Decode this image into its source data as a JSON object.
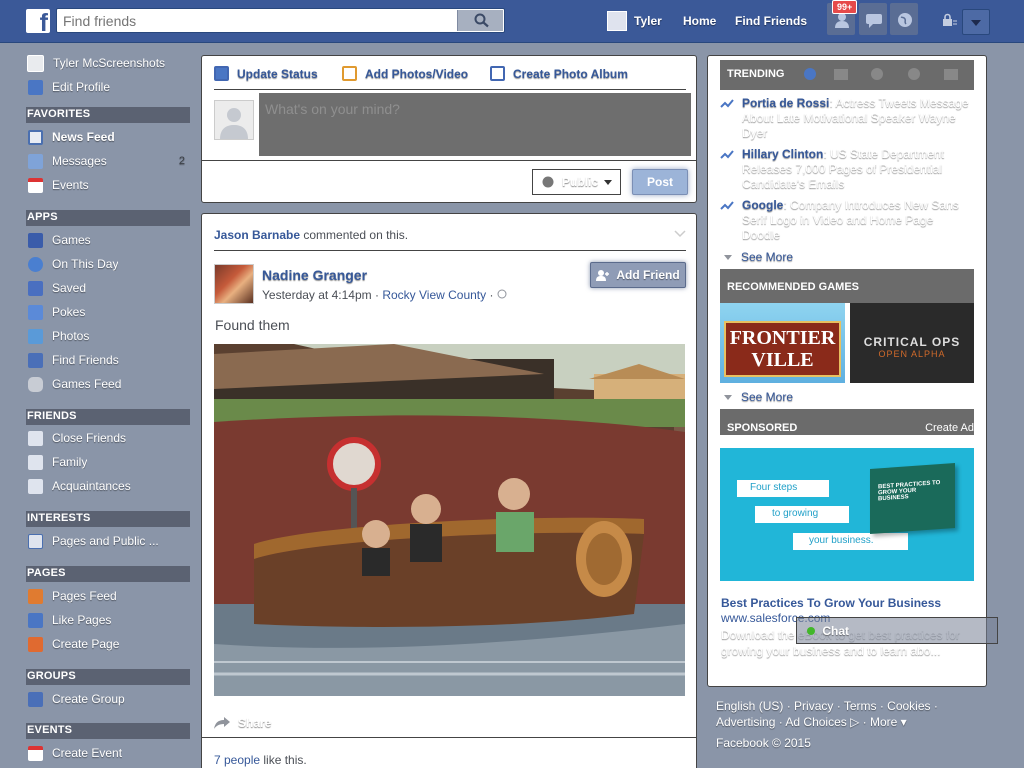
{
  "topbar": {
    "logo": "f",
    "search_placeholder": "Find friends",
    "user_name": "Tyler",
    "home_label": "Home",
    "find_friends_label": "Find Friends",
    "notification_count": "99+",
    "brand_color": "#3b5998"
  },
  "leftnav": {
    "profile_name": "Tyler McScreenshots",
    "edit_profile": "Edit Profile",
    "favorites_header": "FAVORITES",
    "favorites": [
      {
        "label": "News Feed",
        "icon": "news-feed-icon"
      },
      {
        "label": "Messages",
        "count": "2",
        "icon": "messages-icon"
      },
      {
        "label": "Events",
        "icon": "calendar-icon"
      }
    ],
    "apps_header": "APPS",
    "apps": [
      {
        "label": "Games",
        "icon": "games-icon"
      },
      {
        "label": "On This Day",
        "icon": "clock-icon"
      },
      {
        "label": "Saved",
        "icon": "bookmark-icon"
      },
      {
        "label": "Pokes",
        "icon": "poke-icon"
      },
      {
        "label": "Photos",
        "icon": "photos-icon"
      },
      {
        "label": "Find Friends",
        "icon": "friends-icon"
      },
      {
        "label": "Games Feed",
        "icon": "gamepad-icon"
      }
    ],
    "friends_header": "FRIENDS",
    "friends": [
      {
        "label": "Close Friends",
        "icon": "star-friends-icon"
      },
      {
        "label": "Family",
        "icon": "family-icon"
      },
      {
        "label": "Acquaintances",
        "icon": "acquaintances-icon"
      }
    ],
    "interests_header": "INTERESTS",
    "interests": [
      {
        "label": "Pages and Public ...",
        "icon": "pages-icon"
      }
    ],
    "pages_header": "PAGES",
    "pages": [
      {
        "label": "Pages Feed",
        "icon": "flag-icon"
      },
      {
        "label": "Like Pages",
        "icon": "like-icon"
      },
      {
        "label": "Create Page",
        "icon": "create-page-icon"
      }
    ],
    "groups_header": "GROUPS",
    "groups": [
      {
        "label": "Create Group",
        "icon": "create-group-icon"
      }
    ],
    "events_header": "EVENTS",
    "events": [
      {
        "label": "Create Event",
        "icon": "create-event-icon"
      }
    ]
  },
  "composer": {
    "tab_status": "Update Status",
    "tab_photo": "Add Photos/Video",
    "tab_album": "Create Photo Album",
    "placeholder": "What's on your mind?",
    "privacy": "Public",
    "post": "Post"
  },
  "story": {
    "context_actor": "Jason Barnabe",
    "context_text": " commented on this.",
    "author": "Nadine Granger",
    "time": "Yesterday at 4:14pm",
    "separator": " · ",
    "location": "Rocky View County",
    "add_friend": "Add Friend",
    "text": "Found them",
    "share": "Share",
    "likes_count": "7 people",
    "likes_text": " like this."
  },
  "rightcol": {
    "trending_header": "TRENDING",
    "trends": [
      {
        "name": "Portia de Rossi",
        "text": ": Actress Tweets Message About Late Motivational Speaker Wayne Dyer"
      },
      {
        "name": "Hillary Clinton",
        "text": ": US State Department Releases 7,000 Pages of Presidential Candidate's Emails"
      },
      {
        "name": "Google",
        "text": ": Company Introduces New Sans Serif Logo in Video and Home Page Doodle"
      }
    ],
    "see_more": "See More",
    "games_header": "RECOMMENDED GAMES",
    "game1": "FRONTIER VILLE",
    "game2_title": "CRITICAL OPS",
    "game2_sub": "OPEN ALPHA",
    "see_more_games": "See More",
    "sponsored_header": "SPONSORED",
    "create_ad": "Create Ad",
    "ad_line1": "Four steps",
    "ad_line2": "to growing",
    "ad_line3": "your business.",
    "ad_book": "BEST PRACTICES TO GROW YOUR BUSINESS",
    "ad_title": "Best Practices To Grow Your Business",
    "ad_url": "www.salesforce.com",
    "ad_desc": "Download the eBook to get best practices for growing your business and to learn abo..."
  },
  "footer": {
    "english": "English (US)",
    "privacy": "Privacy",
    "terms": "Terms",
    "cookies": "Cookies",
    "advertising": "Advertising",
    "ad_choices": "Ad Choices",
    "more": "More",
    "copyright": "Facebook © 2015",
    "sep": " · "
  },
  "chat": {
    "label": "Chat"
  }
}
